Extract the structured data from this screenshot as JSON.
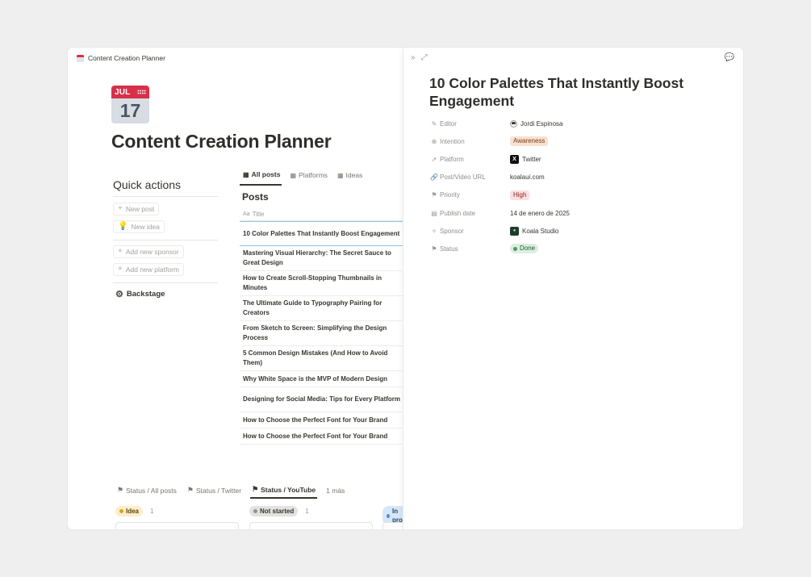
{
  "breadcrumb": {
    "title": "Content Creation Planner"
  },
  "page": {
    "calendar_month": "JUL",
    "calendar_day": "17",
    "title": "Content Creation Planner"
  },
  "quick_actions": {
    "title": "Quick actions",
    "new_post": "New post",
    "new_idea": "New idea",
    "add_sponsor": "Add new sponsor",
    "add_platform": "Add new platform",
    "backstage": "Backstage"
  },
  "tabs": [
    {
      "label": "All posts",
      "active": true
    },
    {
      "label": "Platforms",
      "active": false
    },
    {
      "label": "Ideas",
      "active": false
    }
  ],
  "posts": {
    "title": "Posts",
    "column_title": "Title",
    "column_icon": "Aa",
    "rows": [
      "10 Color Palettes That Instantly Boost Engagement",
      "Mastering Visual Hierarchy: The Secret Sauce to Great Design",
      "How to Create Scroll-Stopping Thumbnails in Minutes",
      "The Ultimate Guide to Typography Pairing for Creators",
      "From Sketch to Screen: Simplifying the Design Process",
      "5 Common Design Mistakes (And How to Avoid Them)",
      "Why White Space is the MVP of Modern Design",
      "Designing for Social Media: Tips for Every Platform",
      "How to Choose the Perfect Font for Your Brand",
      "How to Choose the Perfect Font for Your Brand"
    ]
  },
  "board_tabs": [
    {
      "label": "Status / All posts",
      "active": false
    },
    {
      "label": "Status / Twitter",
      "active": false
    },
    {
      "label": "Status / YouTube",
      "active": true
    },
    {
      "label": "1 más",
      "active": false
    }
  ],
  "board": {
    "lanes": [
      {
        "label": "Idea",
        "count": "1",
        "bg": "#fbeecb",
        "dot": "#d9a51f",
        "color": "#5b4410"
      },
      {
        "label": "Not started",
        "count": "1",
        "bg": "#e3e2e0",
        "dot": "#91918e",
        "color": "#37352f"
      },
      {
        "label": "In progress",
        "count": "",
        "bg": "#d6e6f5",
        "dot": "#4d8fd1",
        "color": "#1f4a75"
      }
    ]
  },
  "panel": {
    "title": "10 Color Palettes That Instantly Boost Engagement",
    "properties": {
      "editor_label": "Editor",
      "editor_value": "Jordi Espinosa",
      "intention_label": "Intention",
      "intention_value": "Awareness",
      "platform_label": "Platform",
      "platform_value": "Twitter",
      "url_label": "Post/Video URL",
      "url_value": "koalaui.com",
      "priority_label": "Priority",
      "priority_value": "High",
      "publish_label": "Publish date",
      "publish_value": "14 de enero de 2025",
      "sponsor_label": "Sponsor",
      "sponsor_value": "Koala Studio",
      "status_label": "Status",
      "status_value": "Done"
    }
  },
  "colors": {
    "accent_red": "#d9304a",
    "awareness_bg": "#f9e1d2",
    "high_bg": "#fbe0e0",
    "done_bg": "#dcefe0"
  }
}
